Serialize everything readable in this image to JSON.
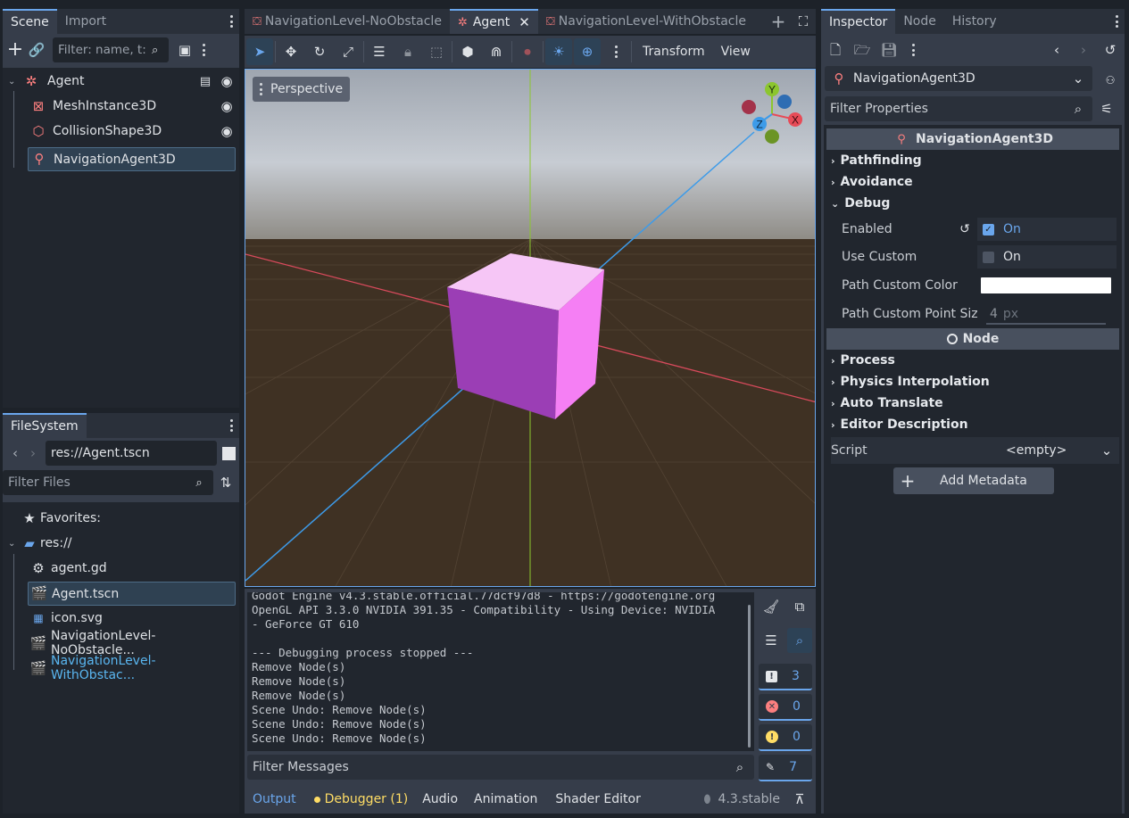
{
  "scene_panel": {
    "tabs": [
      "Scene",
      "Import"
    ],
    "filter_placeholder": "Filter: name, t:t",
    "nodes": [
      {
        "label": "Agent",
        "icon": "node3d-icon"
      },
      {
        "label": "MeshInstance3D",
        "icon": "mesh-icon"
      },
      {
        "label": "CollisionShape3D",
        "icon": "collision-icon"
      },
      {
        "label": "NavigationAgent3D",
        "icon": "nav-agent-icon"
      }
    ]
  },
  "filesystem": {
    "tab": "FileSystem",
    "path": "res://Agent.tscn",
    "filter_placeholder": "Filter Files",
    "favorites": "Favorites:",
    "root": "res://",
    "files": [
      {
        "label": "agent.gd"
      },
      {
        "label": "Agent.tscn"
      },
      {
        "label": "icon.svg"
      },
      {
        "label": "NavigationLevel-NoObstacle..."
      },
      {
        "label": "NavigationLevel-WithObstac..."
      }
    ]
  },
  "editor_tabs": [
    "NavigationLevel-NoObstacle",
    "Agent",
    "NavigationLevel-WithObstacle"
  ],
  "toolbar": {
    "transform": "Transform",
    "view": "View"
  },
  "viewport": {
    "perspective_label": "Perspective",
    "gizmo": {
      "x": "X",
      "y": "Y",
      "z": "Z"
    }
  },
  "console": {
    "lines": [
      "Godot Engine v4.3.stable.official.77dcf97d8 - https://godotengine.org",
      "OpenGL API 3.3.0 NVIDIA 391.35 - Compatibility - Using Device: NVIDIA",
      "- GeForce GT 610",
      "",
      "--- Debugging process stopped ---",
      "Remove Node(s)",
      "Remove Node(s)",
      "Remove Node(s)",
      "Scene Undo: Remove Node(s)",
      "Scene Undo: Remove Node(s)",
      "Scene Undo: Remove Node(s)"
    ],
    "filter_placeholder": "Filter Messages",
    "counts": {
      "messages": "3",
      "errors": "0",
      "warnings": "0",
      "editor": "7"
    }
  },
  "bottom_tabs": [
    "Output",
    "Debugger (1)",
    "Audio",
    "Animation",
    "Shader Editor"
  ],
  "version": "4.3.stable",
  "inspector": {
    "tabs": [
      "Inspector",
      "Node",
      "History"
    ],
    "node_selector": "NavigationAgent3D",
    "filter_placeholder": "Filter Properties",
    "class_header": "NavigationAgent3D",
    "sections": [
      "Pathfinding",
      "Avoidance",
      "Debug"
    ],
    "props": {
      "enabled_label": "Enabled",
      "enabled_value": "On",
      "use_custom_label": "Use Custom",
      "use_custom_value": "On",
      "path_color_label": "Path Custom Color",
      "path_point_label": "Path Custom Point Siz",
      "path_point_value": "4",
      "path_point_unit": "px"
    },
    "node_header": "Node",
    "node_sections": [
      "Process",
      "Physics Interpolation",
      "Auto Translate",
      "Editor Description"
    ],
    "script_label": "Script",
    "script_value": "<empty>",
    "add_metadata": "Add Metadata"
  }
}
